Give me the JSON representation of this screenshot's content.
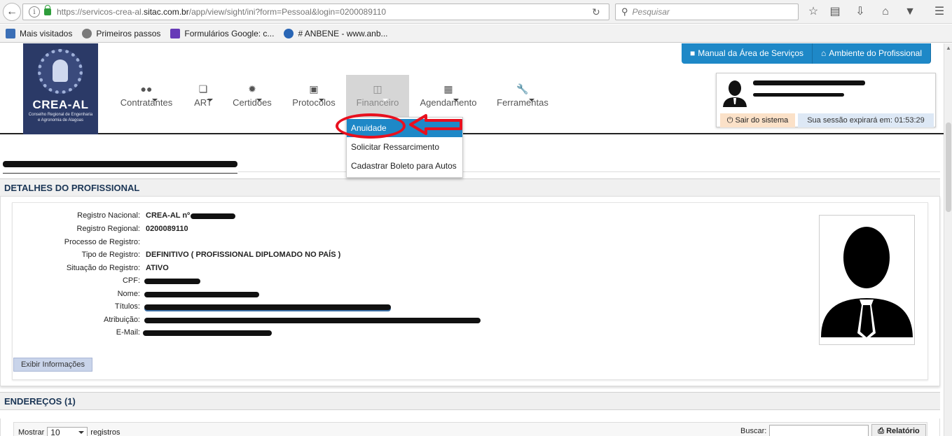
{
  "browser": {
    "url_prefix": "https://servicos-crea-al.",
    "url_domain": "sitac.com.br",
    "url_suffix": "/app/view/sight/ini?form=Pessoal&login=0200089110",
    "search_placeholder": "Pesquisar",
    "bookmarks": [
      {
        "label": "Mais visitados",
        "color": "#3b6fb6"
      },
      {
        "label": "Primeiros passos",
        "color": "#7a7a7a"
      },
      {
        "label": "Formulários Google: c...",
        "color": "#673ab7"
      },
      {
        "label": "# ANBENE - www.anb...",
        "color": "#2a66b5"
      }
    ]
  },
  "logo": {
    "name": "CREA-AL",
    "subtitle": "Conselho Regional de Engenharia e Agronomia de Alagoas"
  },
  "nav": [
    {
      "label": "Contratantes",
      "icon": "users-icon"
    },
    {
      "label": "ART",
      "icon": "copy-icon"
    },
    {
      "label": "Certidões",
      "icon": "cog-icon"
    },
    {
      "label": "Protocolos",
      "icon": "inbox-icon"
    },
    {
      "label": "Financeiro",
      "icon": "money-icon"
    },
    {
      "label": "Agendamento",
      "icon": "calendar-icon"
    },
    {
      "label": "Ferramentas",
      "icon": "wrench-icon"
    }
  ],
  "top_buttons": {
    "manual": "Manual da Área de Serviços",
    "ambiente": "Ambiente do Profissional"
  },
  "user": {
    "logout": "Sair do sistema",
    "session": "Sua sessão expirará em: 01:53:29"
  },
  "dropdown": {
    "items": [
      "Anuidade",
      "Solicitar Ressarcimento",
      "Cadastrar Boleto para Autos"
    ]
  },
  "sections": {
    "details": "DETALHES DO PROFISSIONAL",
    "addresses": "ENDEREÇOS (1)"
  },
  "fields": [
    {
      "label": "Registro Nacional:",
      "value": "CREA-AL nº"
    },
    {
      "label": "Registro Regional:",
      "value": "0200089110"
    },
    {
      "label": "Processo de Registro:",
      "value": ""
    },
    {
      "label": "Tipo de Registro:",
      "value": "DEFINITIVO ( PROFISSIONAL DIPLOMADO NO PAÍS )"
    },
    {
      "label": "Situação do Registro:",
      "value": "ATIVO"
    },
    {
      "label": "CPF:",
      "value": ""
    },
    {
      "label": "Nome:",
      "value": ""
    },
    {
      "label": "Títulos:",
      "value": ""
    },
    {
      "label": "Atribuição:",
      "value": ""
    },
    {
      "label": "E-Mail:",
      "value": ""
    }
  ],
  "show_info_button": "Exibir Informações",
  "list": {
    "show_label": "Mostrar",
    "show_value": "10",
    "records_label": "registros",
    "search_label": "Buscar:",
    "report_button": "Relatório"
  },
  "colors": {
    "accent": "#1e88c7",
    "logo_bg": "#2b3a67",
    "annotation": "#e8101e"
  }
}
